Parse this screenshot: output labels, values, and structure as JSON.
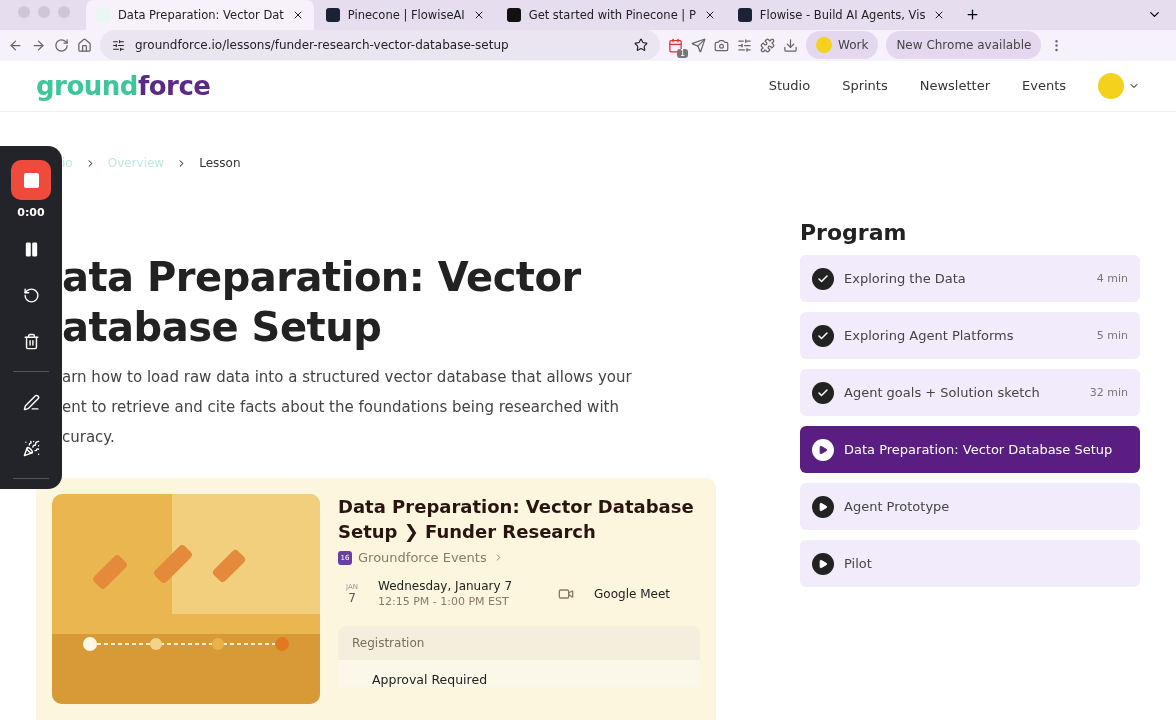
{
  "browser": {
    "tabs": [
      {
        "title": "Data Preparation: Vector Dat",
        "selected": true,
        "kind": "light"
      },
      {
        "title": "Pinecone | FlowiseAI",
        "selected": false,
        "kind": "dark"
      },
      {
        "title": "Get started with Pinecone | P",
        "selected": false,
        "kind": "black"
      },
      {
        "title": "Flowise - Build AI Agents, Vis",
        "selected": false,
        "kind": "dark"
      }
    ],
    "url": "groundforce.io/lessons/funder-research-vector-database-setup",
    "extension_badge": "1",
    "profile": "Work",
    "update_button": "New Chrome available"
  },
  "site": {
    "logo": [
      {
        "text": "ground",
        "color": "#3fc59a"
      },
      {
        "text": "force",
        "color": "#5b2a86"
      }
    ],
    "nav": [
      "Studio",
      "Sprints",
      "Newsletter",
      "Events"
    ]
  },
  "recorder": {
    "time": "0:00"
  },
  "breadcrumbs": [
    {
      "label": "io",
      "current": false
    },
    {
      "label": "Overview",
      "current": false
    },
    {
      "label": "Lesson",
      "current": true
    }
  ],
  "lesson": {
    "title_lines": [
      "ata Preparation: Vector",
      "atabase Setup"
    ],
    "description_lines": [
      "arn how to load raw data into a structured vector database that allows your",
      "ent to retrieve and cite facts about the foundations being researched with",
      "curacy."
    ]
  },
  "event": {
    "kind": "picture",
    "title": "Data Preparation: Vector Database Setup ❯ Funder Research",
    "calendar": "Groundforce Events",
    "calendar_icon": "16",
    "month": "JAN",
    "day": "7",
    "date": "Wednesday, January 7",
    "time": "12:15 PM - 1:00 PM EST",
    "location": "Google Meet",
    "registration_heading": "Registration",
    "registration_status": "Approval Required"
  },
  "program": {
    "title": "Program",
    "items": [
      {
        "title": "Exploring the Data",
        "duration": "4 min",
        "kind": "done",
        "selected": false
      },
      {
        "title": "Exploring Agent Platforms",
        "duration": "5 min",
        "kind": "done",
        "selected": false
      },
      {
        "title": "Agent goals + Solution sketch",
        "duration": "32 min",
        "kind": "done",
        "selected": false
      },
      {
        "title": "Data Preparation: Vector Database Setup",
        "kind": "upcoming",
        "selected": true
      },
      {
        "title": "Agent Prototype",
        "kind": "upcoming",
        "selected": false
      },
      {
        "title": "Pilot",
        "kind": "upcoming",
        "selected": false
      }
    ]
  }
}
